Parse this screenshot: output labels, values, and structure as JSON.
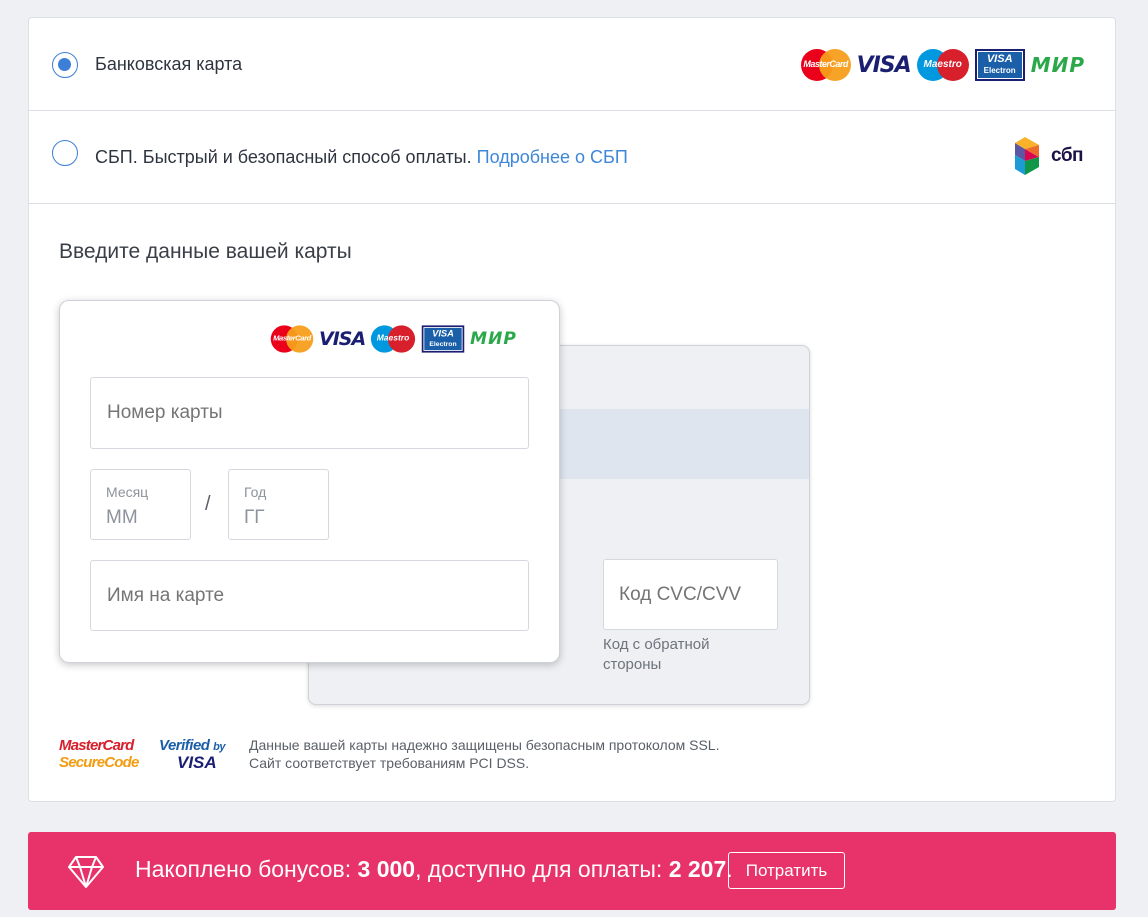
{
  "payment_methods": [
    {
      "label": "Банковская карта",
      "selected": true
    },
    {
      "label": "СБП. Быстрый и безопасный способ оплаты.",
      "link": "Подробнее о СБП",
      "selected": false
    }
  ],
  "card_brands": {
    "mastercard": "MasterCard",
    "visa": "VISA",
    "maestro": "Maestro",
    "visa_electron_top": "VISA",
    "visa_electron_bottom": "Electron",
    "mir": "МИР"
  },
  "sbp_logo_text": "сбп",
  "form": {
    "title": "Введите данные вашей карты",
    "card_number_placeholder": "Номер карты",
    "month_label": "Месяц",
    "month_placeholder": "ММ",
    "separator": "/",
    "year_label": "Год",
    "year_placeholder": "ГГ",
    "name_placeholder": "Имя на карте",
    "cvc_placeholder": "Код CVC/CVV",
    "cvc_hint": "Код с обратной стороны"
  },
  "security": {
    "mc_secure_line1": "MasterCard",
    "mc_secure_line2": "SecureCode",
    "vbv_line1": "Verified",
    "vbv_by": "by",
    "vbv_line2": "VISA",
    "text_line1": "Данные вашей карты надежно защищены безопасным протоколом SSL.",
    "text_line2": "Сайт соответствует требованиям PCI DSS."
  },
  "bonus": {
    "prefix": "Накоплено бонусов: ",
    "accumulated": "3 000",
    "middle": ", доступно для оплаты: ",
    "available": "2 207",
    "suffix": ".",
    "button": "Потратить"
  },
  "colors": {
    "accent": "#3d7fd6",
    "bonus_bg": "#e7336a",
    "link": "#3d86d8"
  }
}
